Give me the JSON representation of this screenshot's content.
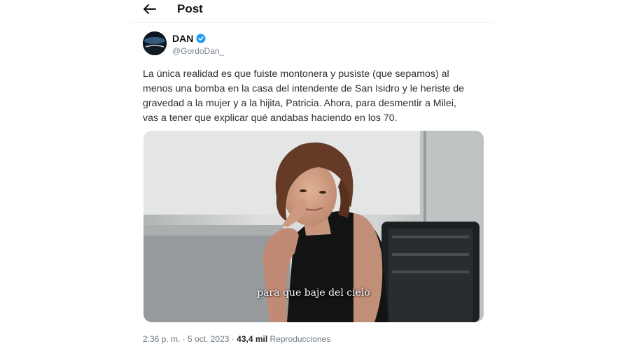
{
  "header": {
    "title": "Post"
  },
  "author": {
    "name": "DAN",
    "handle": "@GordoDan_",
    "verified_color": "#1d9bf0"
  },
  "tweet": {
    "lines": [
      "La única realidad es que fuiste montonera y pusiste (que sepamos) al",
      "menos una bomba en la casa del intendente de San Isidro y le heriste de",
      "gravedad a la mujer y a la hijita, Patricia. Ahora, para desmentir a Milei,",
      "vas a tener que explicar qué andabas haciendo en los 70."
    ]
  },
  "media": {
    "caption": "para que baje del cielo"
  },
  "meta": {
    "time": "2:36 p. m.",
    "sep1": "·",
    "date": "5 oct. 2023",
    "sep2": "·",
    "views_count": "43,4 mil",
    "views_label": "Reproducciones"
  }
}
